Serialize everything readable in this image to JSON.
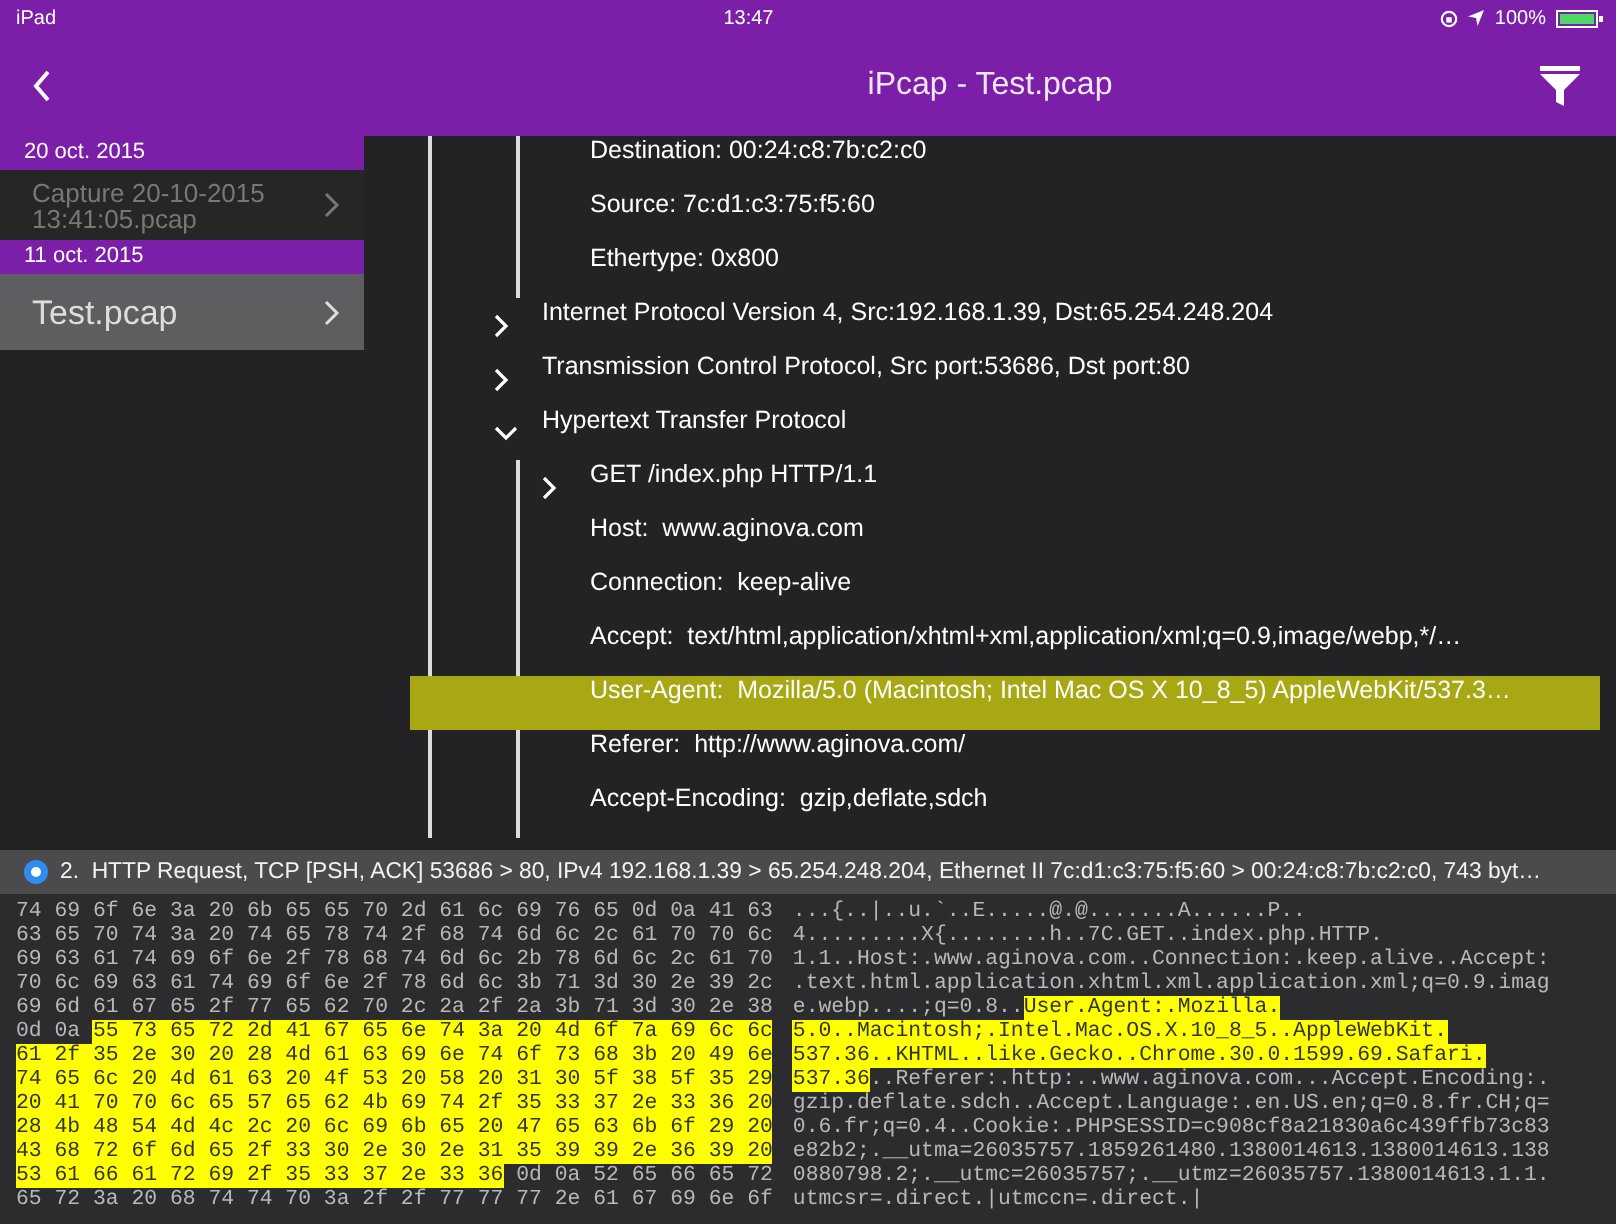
{
  "status_bar": {
    "device": "iPad",
    "time": "13:47",
    "battery": "100%"
  },
  "nav": {
    "title": "iPcap - Test.pcap"
  },
  "sidebar": {
    "sections": [
      {
        "date": "20 oct. 2015",
        "items": [
          {
            "label": "Capture 20-10-2015 13:41:05.pcap",
            "selected": false
          }
        ]
      },
      {
        "date": "11 oct. 2015",
        "items": [
          {
            "label": "Test.pcap",
            "selected": true
          }
        ]
      }
    ]
  },
  "tree": [
    {
      "children": [
        {
          "label": "Destination: 00:24:c8:7b:c2:c0",
          "selected": false
        },
        {
          "label": "Source: 7c:d1:c3:75:f5:60",
          "selected": false
        },
        {
          "label": "Ethertype: 0x800",
          "selected": false
        }
      ]
    },
    {
      "label": "Internet Protocol Version 4, Src:192.168.1.39, Dst:65.254.248.204",
      "expanded": false,
      "selected": false
    },
    {
      "label": "Transmission Control Protocol, Src port:53686, Dst port:80",
      "expanded": false,
      "selected": false
    },
    {
      "label": "Hypertext Transfer Protocol",
      "expanded": true,
      "selected": false,
      "children": [
        {
          "label": "GET /index.php HTTP/1.1",
          "expanded": false,
          "selected": false
        },
        {
          "label": "Host:  www.aginova.com",
          "selected": false
        },
        {
          "label": "Connection:  keep-alive",
          "selected": false
        },
        {
          "label": "Accept:  text/html,application/xhtml+xml,application/xml;q=0.9,image/webp,*/…",
          "selected": false
        },
        {
          "label": "User-Agent:  Mozilla/5.0 (Macintosh; Intel Mac OS X 10_8_5) AppleWebKit/537.3…",
          "selected": true
        },
        {
          "label": "Referer:  http://www.aginova.com/",
          "selected": false
        },
        {
          "label": "Accept-Encoding:  gzip,deflate,sdch",
          "selected": false
        }
      ]
    }
  ],
  "packet_summary": {
    "text": "2.  HTTP Request, TCP [PSH, ACK] 53686 > 80, IPv4 192.168.1.39 > 65.254.248.204, Ethernet II 7c:d1:c3:75:f5:60 > 00:24:c8:7b:c2:c0, 743 byt…"
  },
  "hex_dump": {
    "hex_rows": [
      [
        {
          "text": "74 69 6f 6e 3a 20 6b 65 65 70 2d 61 6c 69 76 65 0d 0a 41 63",
          "highlighted": false
        }
      ],
      [
        {
          "text": "63 65 70 74 3a 20 74 65 78 74 2f 68 74 6d 6c 2c 61 70 70 6c",
          "highlighted": false
        }
      ],
      [
        {
          "text": "69 63 61 74 69 6f 6e 2f 78 68 74 6d 6c 2b 78 6d 6c 2c 61 70",
          "highlighted": false
        }
      ],
      [
        {
          "text": "70 6c 69 63 61 74 69 6f 6e 2f 78 6d 6c 3b 71 3d 30 2e 39 2c",
          "highlighted": false
        }
      ],
      [
        {
          "text": "69 6d 61 67 65 2f 77 65 62 70 2c 2a 2f 2a 3b 71 3d 30 2e 38",
          "highlighted": false
        }
      ],
      [
        {
          "text": "0d 0a",
          "highlighted": false
        },
        {
          "text": "55 73 65 72 2d 41 67 65 6e 74 3a 20 4d 6f 7a 69 6c 6c",
          "highlighted": true
        }
      ],
      [
        {
          "text": "61 2f 35 2e 30 20 28 4d 61 63 69 6e 74 6f 73 68 3b 20 49 6e",
          "highlighted": true
        }
      ],
      [
        {
          "text": "74 65 6c 20 4d 61 63 20 4f 53 20 58 20 31 30 5f 38 5f 35 29",
          "highlighted": true
        }
      ],
      [
        {
          "text": "20 41 70 70 6c 65 57 65 62 4b 69 74 2f 35 33 37 2e 33 36 20",
          "highlighted": true
        }
      ],
      [
        {
          "text": "28 4b 48 54 4d 4c 2c 20 6c 69 6b 65 20 47 65 63 6b 6f 29 20",
          "highlighted": true
        }
      ],
      [
        {
          "text": "43 68 72 6f 6d 65 2f 33 30 2e 30 2e 31 35 39 39 2e 36 39 20",
          "highlighted": true
        }
      ],
      [
        {
          "text": "53 61 66 61 72 69 2f 35 33 37 2e 33 36",
          "highlighted": true
        },
        {
          "text": "0d 0a 52 65 66 65 72",
          "highlighted": false
        }
      ],
      [
        {
          "text": "65 72 3a 20 68 74 74 70 3a 2f 2f 77 77 77 2e 61 67 69 6e 6f",
          "highlighted": false
        }
      ]
    ],
    "ascii_rows": [
      [
        {
          "text": "...{..|..u.`..E.....@.@.......A......P..",
          "highlighted": false
        }
      ],
      [
        {
          "text": "4.........X{........h..7C.GET..index.php.HTTP.",
          "highlighted": false
        }
      ],
      [
        {
          "text": "1.1..Host:.www.aginova.com..Connection:.keep.alive..Accept:",
          "highlighted": false
        }
      ],
      [
        {
          "text": ".text.html.application.xhtml.xml.application.xml;q=0.9.imag",
          "highlighted": false
        }
      ],
      [
        {
          "text": "e.webp....;q=0.8..",
          "highlighted": false
        },
        {
          "text": "User.Agent:.Mozilla.",
          "highlighted": true
        }
      ],
      [
        {
          "text": "5.0..Macintosh;.Intel.Mac.OS.X.10_8_5..AppleWebKit.",
          "highlighted": true
        }
      ],
      [
        {
          "text": "537.36..KHTML..like.Gecko..Chrome.30.0.1599.69.Safari.",
          "highlighted": true
        }
      ],
      [
        {
          "text": "537.36",
          "highlighted": true
        },
        {
          "text": "..Referer:.http:..www.aginova.com...Accept.Encoding:.",
          "highlighted": false
        }
      ],
      [
        {
          "text": "gzip.deflate.sdch..Accept.Language:.en.US.en;q=0.8.fr.CH;q=",
          "highlighted": false
        }
      ],
      [
        {
          "text": "0.6.fr;q=0.4..Cookie:.PHPSESSID=c908cf8a21830a6c439ffb73c83",
          "highlighted": false
        }
      ],
      [
        {
          "text": "e82b2;.__utma=26035757.1859261480.1380014613.1380014613.138",
          "highlighted": false
        }
      ],
      [
        {
          "text": "0880798.2;.__utmc=26035757;.__utmz=26035757.1380014613.1.1.",
          "highlighted": false
        }
      ],
      [
        {
          "text": "utmcsr=.direct.|utmccn=.direct.|",
          "highlighted": false
        }
      ]
    ]
  }
}
